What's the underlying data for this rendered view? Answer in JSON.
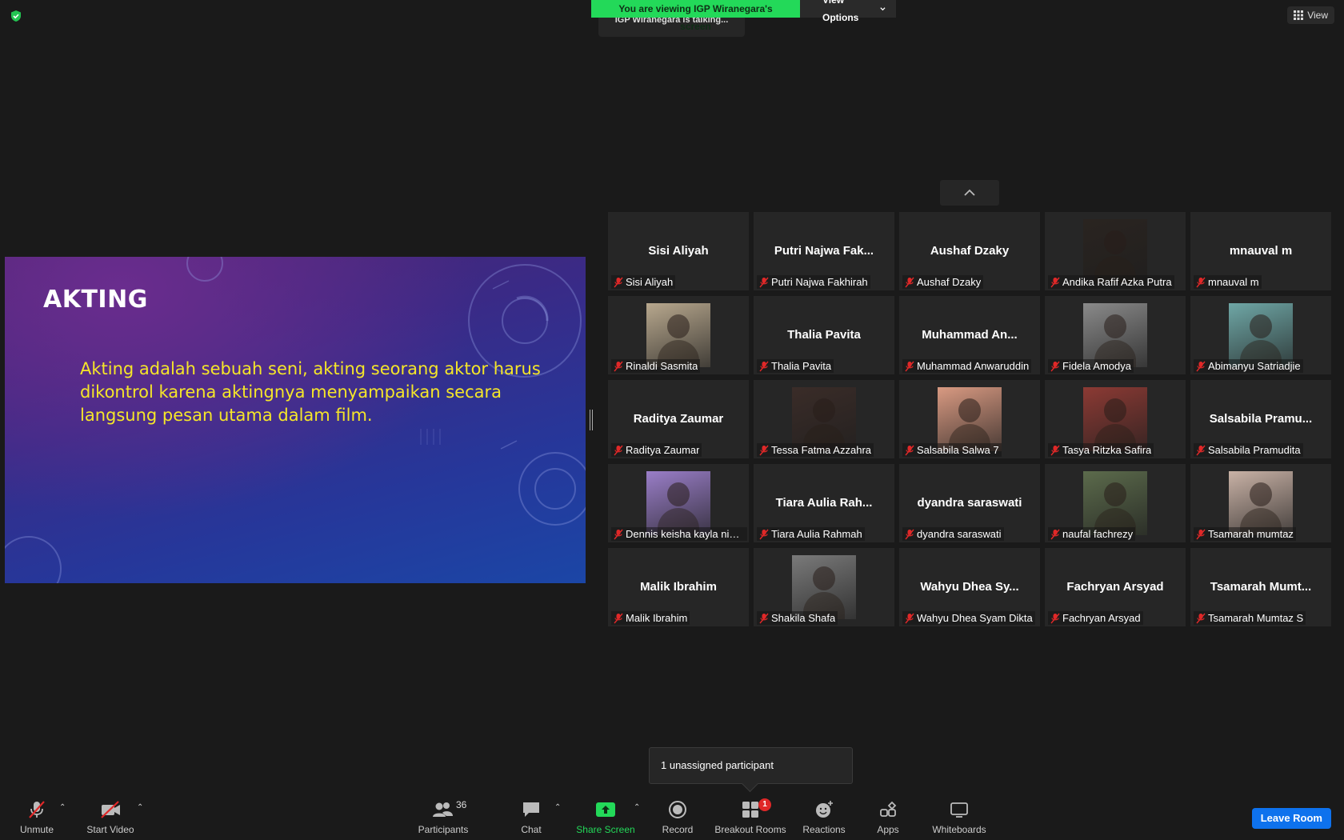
{
  "banner": {
    "sharing_text": "You are viewing IGP Wiranegara's screen",
    "view_options": "View Options",
    "talking_text": "IGP Wiranegara is talking..."
  },
  "view_button": "View",
  "slide": {
    "title": "AKTING",
    "body": "Akting adalah sebuah seni, akting seorang aktor harus dikontrol karena aktingnya menyampaikan secara langsung pesan utama dalam film."
  },
  "participants": [
    {
      "display": "Sisi Aliyah",
      "label": "Sisi Aliyah",
      "video": false
    },
    {
      "display": "Putri Najwa Fak...",
      "label": "Putri Najwa Fakhirah",
      "video": false
    },
    {
      "display": "Aushaf Dzaky",
      "label": "Aushaf Dzaky",
      "video": false
    },
    {
      "display": "",
      "label": "Andika Rafif Azka Putra",
      "video": true,
      "color": "#2a2420"
    },
    {
      "display": "mnauval m",
      "label": "mnauval m",
      "video": false
    },
    {
      "display": "",
      "label": "Rinaldi Sasmita",
      "video": true,
      "color": "#b8a88e"
    },
    {
      "display": "Thalia Pavita",
      "label": "Thalia Pavita",
      "video": false
    },
    {
      "display": "Muhammad An...",
      "label": "Muhammad Anwaruddin",
      "video": false
    },
    {
      "display": "",
      "label": "Fidela Amodya",
      "video": true,
      "color": "#8a8a8a"
    },
    {
      "display": "",
      "label": "Abimanyu Satriadjie",
      "video": true,
      "color": "#6fa7a6"
    },
    {
      "display": "Raditya Zaumar",
      "label": "Raditya Zaumar",
      "video": false
    },
    {
      "display": "",
      "label": "Tessa Fatma Azzahra",
      "video": true,
      "color": "#3a2c28"
    },
    {
      "display": "",
      "label": "Salsabila Salwa 7",
      "video": true,
      "color": "#d99a82"
    },
    {
      "display": "",
      "label": "Tasya Ritzka Safira",
      "video": true,
      "color": "#8c3a34"
    },
    {
      "display": "Salsabila Pramu...",
      "label": "Salsabila Pramudita",
      "video": false
    },
    {
      "display": "",
      "label": "Dennis keisha kayla nind...",
      "video": true,
      "color": "#9a7ec8"
    },
    {
      "display": "Tiara Aulia Rah...",
      "label": "Tiara Aulia Rahmah",
      "video": false
    },
    {
      "display": "dyandra saraswati",
      "label": "dyandra saraswati",
      "video": false
    },
    {
      "display": "",
      "label": "naufal fachrezy",
      "video": true,
      "color": "#5c6b4c"
    },
    {
      "display": "",
      "label": "Tsamarah mumtaz",
      "video": true,
      "color": "#c9b2a6"
    },
    {
      "display": "Malik Ibrahim",
      "label": "Malik Ibrahim",
      "video": false
    },
    {
      "display": "",
      "label": "Shakila Shafa",
      "video": true,
      "color": "#7a7a7a"
    },
    {
      "display": "Wahyu Dhea Sy...",
      "label": "Wahyu Dhea Syam Dikta",
      "video": false
    },
    {
      "display": "Fachryan Arsyad",
      "label": "Fachryan Arsyad",
      "video": false
    },
    {
      "display": "Tsamarah Mumt...",
      "label": "Tsamarah Mumtaz S",
      "video": false
    }
  ],
  "tooltip": "1 unassigned participant",
  "toolbar": {
    "unmute": "Unmute",
    "start_video": "Start Video",
    "participants": "Participants",
    "participant_count": "36",
    "chat": "Chat",
    "share_screen": "Share Screen",
    "record": "Record",
    "breakout_rooms": "Breakout Rooms",
    "breakout_badge": "1",
    "reactions": "Reactions",
    "apps": "Apps",
    "whiteboards": "Whiteboards",
    "leave_room": "Leave Room"
  },
  "colors": {
    "share_green": "#23d959",
    "leave_blue": "#0e72ed",
    "muted_red": "#e02828",
    "slide_text_yellow": "#f5e629"
  },
  "icons": [
    "shield-check-icon",
    "chevron-down-icon",
    "grid-view-icon",
    "chevron-up-icon",
    "mic-off-icon",
    "video-off-icon",
    "participants-icon",
    "chat-icon",
    "share-screen-icon",
    "record-icon",
    "breakout-rooms-icon",
    "reactions-icon",
    "apps-icon",
    "whiteboards-icon"
  ]
}
